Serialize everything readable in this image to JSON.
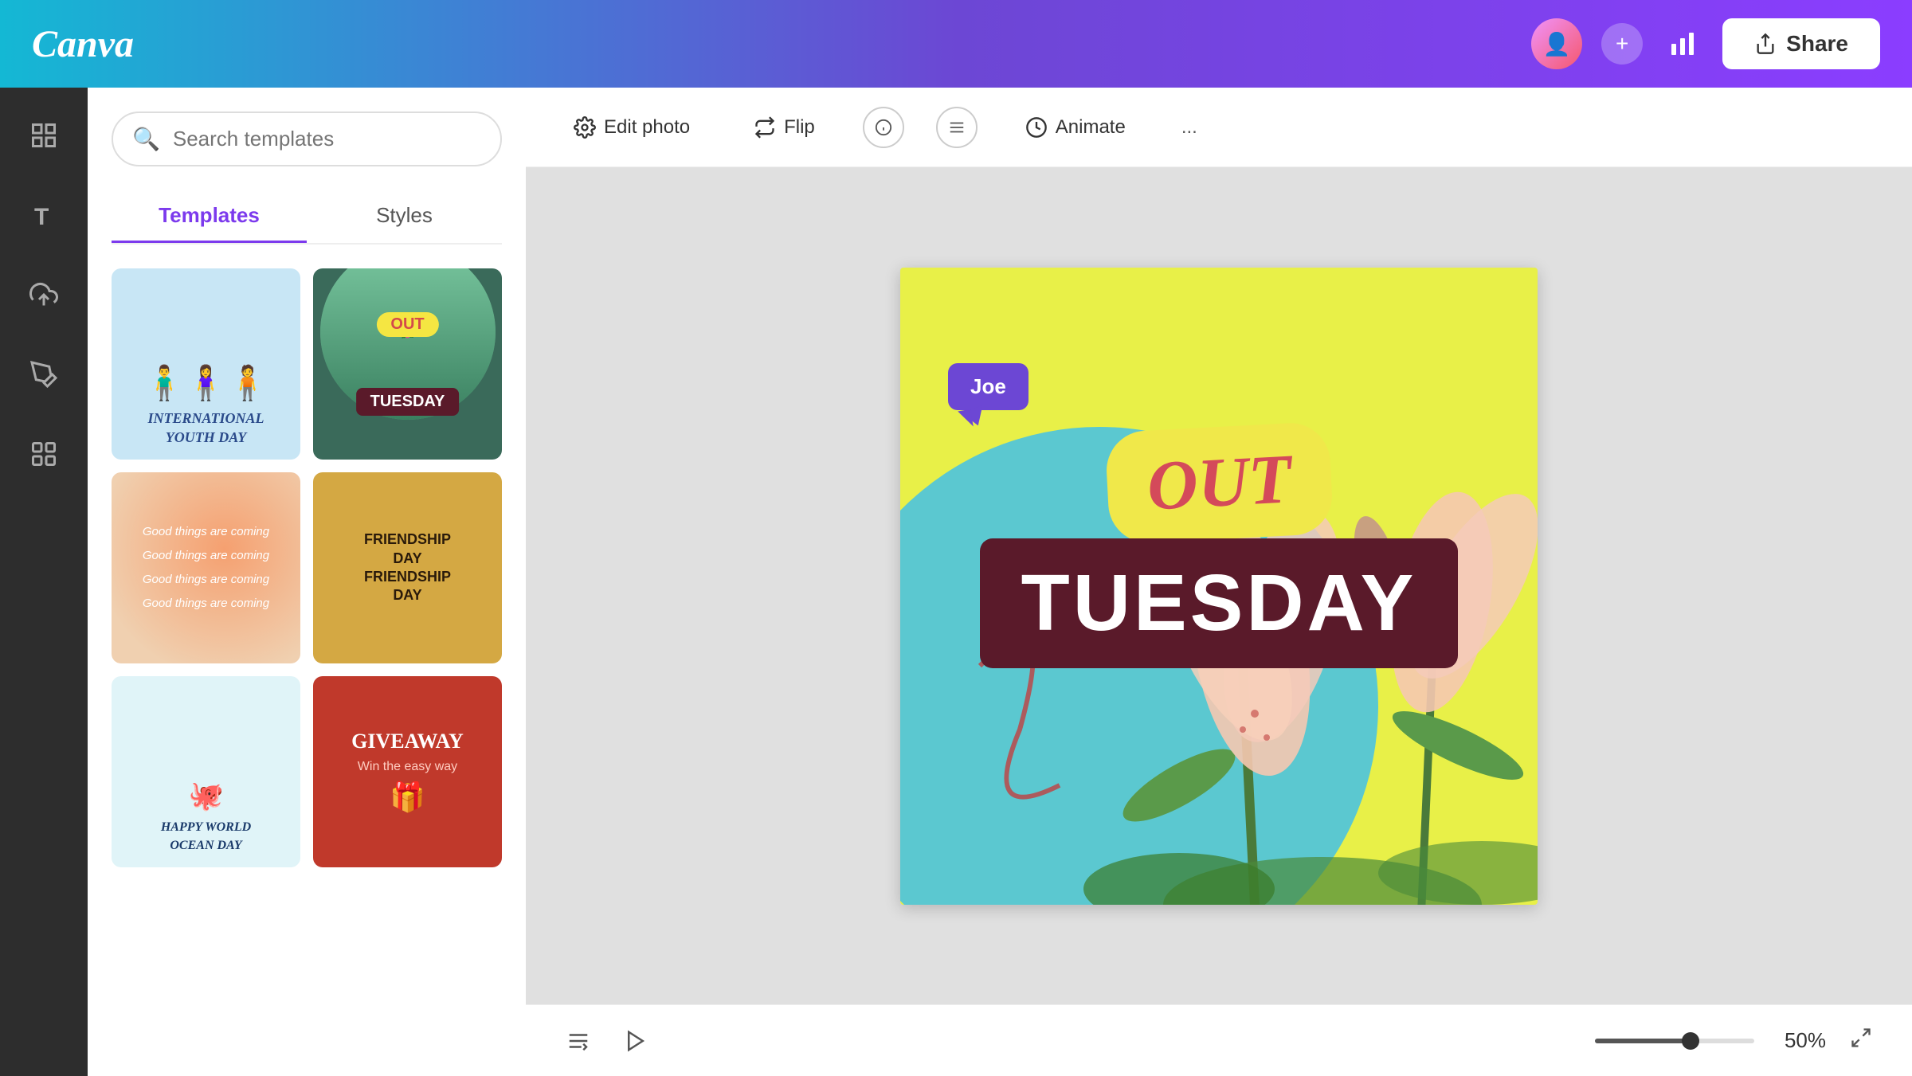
{
  "header": {
    "logo": "Canva",
    "share_label": "Share",
    "plus_icon": "+",
    "analytics_icon": "📊"
  },
  "toolbar": {
    "edit_photo": "Edit photo",
    "flip": "Flip",
    "animate": "Animate",
    "more": "..."
  },
  "templates_panel": {
    "search_placeholder": "Search templates",
    "tab_templates": "Templates",
    "tab_styles": "Styles",
    "cards": [
      {
        "id": "youth",
        "title": "International Youth Day"
      },
      {
        "id": "tuesday",
        "title": "Tuesday Out"
      },
      {
        "id": "good",
        "title": "Good things are coming"
      },
      {
        "id": "friendship",
        "title": "Friendship Day"
      },
      {
        "id": "ocean",
        "title": "Happy World Ocean Day"
      },
      {
        "id": "giveaway",
        "title": "Giveaway - Win the easy way"
      }
    ]
  },
  "canvas": {
    "out_text": "OUT",
    "tuesday_text": "TUESDAY",
    "user_label": "Joe"
  },
  "bottom_bar": {
    "zoom_value": "50%"
  }
}
